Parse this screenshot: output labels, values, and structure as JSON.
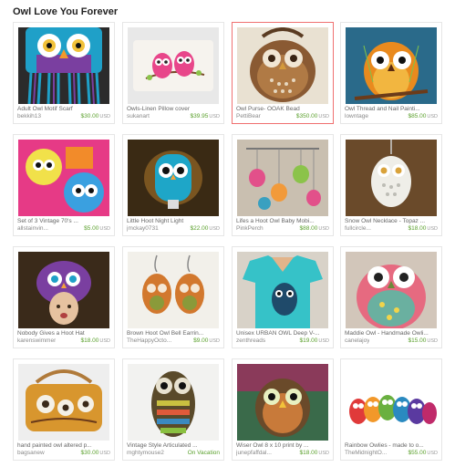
{
  "page": {
    "title": "Owl Love You Forever"
  },
  "items": [
    {
      "title": "Adult Owl Motif Scarf",
      "shop": "bekkih13",
      "price": "$30.00",
      "currency": "USD",
      "icon": "owl-scarf"
    },
    {
      "title": "Owls-Linen Pillow cover",
      "shop": "sukanart",
      "price": "$39.95",
      "currency": "USD",
      "icon": "owl-pillow"
    },
    {
      "title": "Owl Purse- OOAK Bead",
      "shop": "PettiBear",
      "price": "$350.00",
      "currency": "USD",
      "icon": "owl-purse"
    },
    {
      "title": "Owl Thread and Nail Painti...",
      "shop": "lowntage",
      "price": "$85.00",
      "currency": "USD",
      "icon": "owl-string-art"
    },
    {
      "title": "Set of 3 Vintage 70's ...",
      "shop": "allstainvin...",
      "price": "$5.00",
      "currency": "USD",
      "icon": "owl-print"
    },
    {
      "title": "Little Hoot Night Light",
      "shop": "jmckay0731",
      "price": "$22.00",
      "currency": "USD",
      "icon": "owl-night-light"
    },
    {
      "title": "Lifes a Hoot Owl Baby Mobi...",
      "shop": "PinkPerch",
      "price": "$88.00",
      "currency": "USD",
      "icon": "owl-mobile"
    },
    {
      "title": "Snow Owl Necklace - Topaz ...",
      "shop": "fullcircle...",
      "price": "$18.00",
      "currency": "USD",
      "icon": "owl-necklace"
    },
    {
      "title": "Nobody Gives a Hoot Hat",
      "shop": "karenswimmer",
      "price": "$18.00",
      "currency": "USD",
      "icon": "owl-hat"
    },
    {
      "title": "Brown Hoot Owl Bell Earrin...",
      "shop": "TheHappyOcto...",
      "price": "$9.00",
      "currency": "USD",
      "icon": "owl-earrings"
    },
    {
      "title": "Unisex URBAN OWL Deep V-...",
      "shop": "zenthreads",
      "price": "$19.00",
      "currency": "USD",
      "icon": "owl-tshirt"
    },
    {
      "title": "Maddie Owl - Handmade Owli...",
      "shop": "canelajoy",
      "price": "$15.00",
      "currency": "USD",
      "icon": "owl-plush"
    },
    {
      "title": "hand painted owl altered p...",
      "shop": "bagsanew",
      "price": "$30.00",
      "currency": "USD",
      "icon": "owl-clutch"
    },
    {
      "title": "Vintage Style Articulated ...",
      "shop": "mghtymouse2",
      "price": "",
      "currency": "",
      "status": "On Vacation",
      "icon": "owl-pendant"
    },
    {
      "title": "Wiser Owl 8 x 10 print by ...",
      "shop": "junepfaffdal...",
      "price": "$18.00",
      "currency": "USD",
      "icon": "owl-art-print"
    },
    {
      "title": "Rainbow Owlies - made to o...",
      "shop": "TheMidnightO...",
      "price": "$55.00",
      "currency": "USD",
      "icon": "owl-figurines"
    }
  ]
}
